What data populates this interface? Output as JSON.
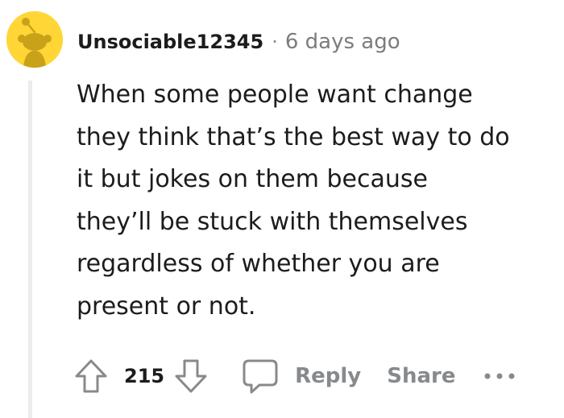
{
  "comment": {
    "author": "Unsociable12345",
    "separator": "·",
    "timestamp": "6 days ago",
    "avatar_icon": "reddit-snoo-avatar-icon",
    "avatar_color": "#ffd635",
    "body_lines": [
      "When some people want change",
      "they think that’s the best way to do",
      "it but jokes on them because",
      "they’ll be stuck with themselves",
      "regardless of whether you are",
      "present or not."
    ]
  },
  "actions": {
    "upvote_icon": "upvote-arrow-icon",
    "score": "215",
    "downvote_icon": "downvote-arrow-icon",
    "reply_icon": "speech-bubble-icon",
    "reply_label": "Reply",
    "share_label": "Share",
    "more_icon": "more-options-icon",
    "muted_color": "#878a8c"
  }
}
